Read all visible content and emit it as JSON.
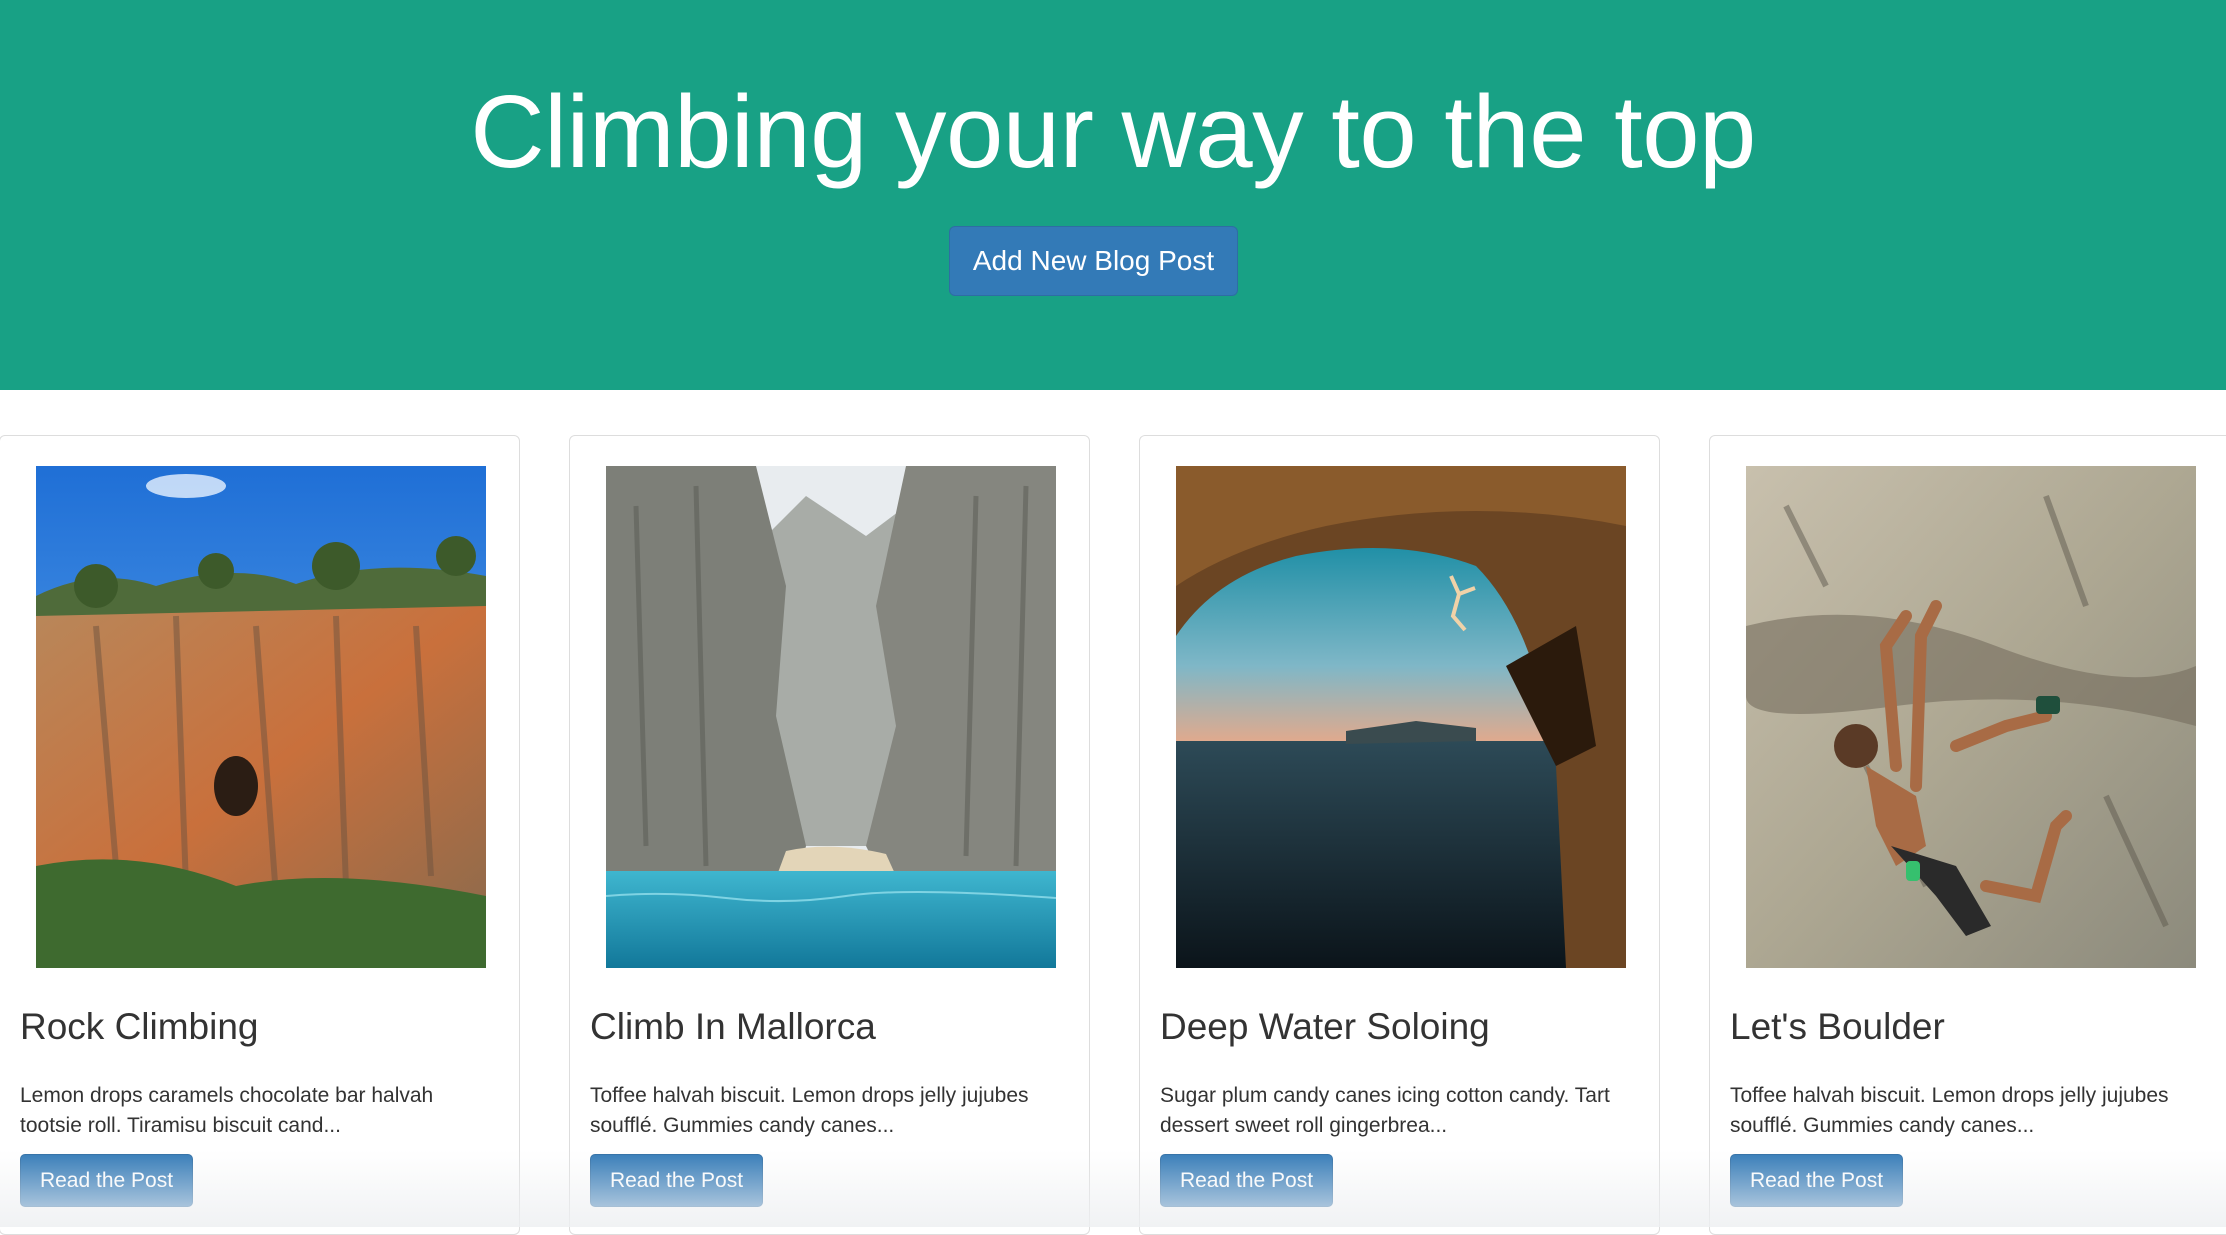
{
  "header": {
    "title": "Climbing your way to the top",
    "add_button_label": "Add New Blog Post"
  },
  "posts": [
    {
      "title": "Rock Climbing",
      "excerpt": "Lemon drops caramels chocolate bar halvah tootsie roll. Tiramisu biscuit cand...",
      "button_label": "Read the Post"
    },
    {
      "title": "Climb In Mallorca",
      "excerpt": "Toffee halvah biscuit. Lemon drops jelly jujubes soufflé. Gummies candy canes...",
      "button_label": "Read the Post"
    },
    {
      "title": "Deep Water Soloing",
      "excerpt": "Sugar plum candy canes icing cotton candy. Tart dessert sweet roll gingerbrea...",
      "button_label": "Read the Post"
    },
    {
      "title": "Let's Boulder",
      "excerpt": "Toffee halvah biscuit. Lemon drops jelly jujubes soufflé. Gummies candy canes...",
      "button_label": "Read the Post"
    }
  ],
  "colors": {
    "hero_background": "#18a185",
    "primary_button": "#337ab7",
    "text": "#333333"
  }
}
